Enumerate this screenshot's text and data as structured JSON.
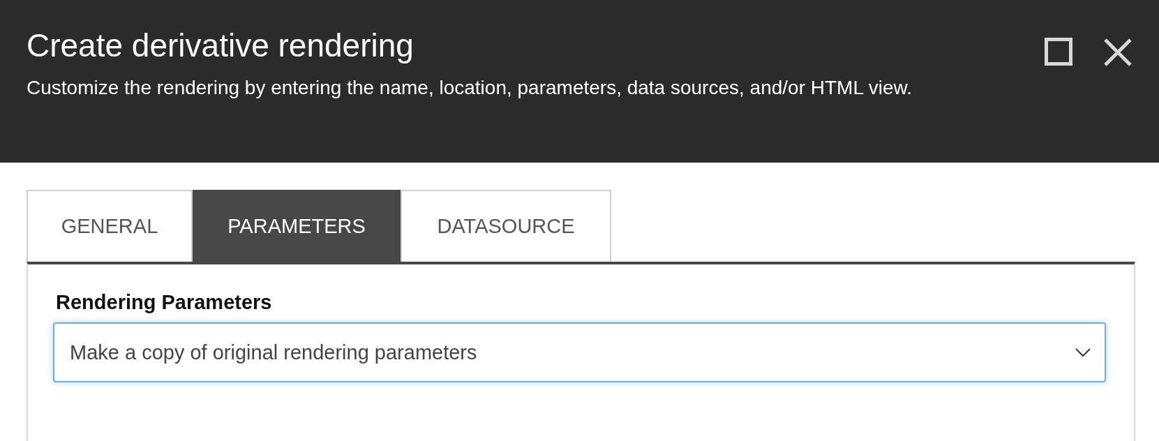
{
  "dialog": {
    "title": "Create derivative rendering",
    "subtitle": "Customize the rendering by entering the name, location, parameters, data sources, and/or HTML view."
  },
  "tabs": [
    {
      "label": "GENERAL",
      "selected": false
    },
    {
      "label": "PARAMETERS",
      "selected": true
    },
    {
      "label": "DATASOURCE",
      "selected": false
    }
  ],
  "form": {
    "label": "Rendering Parameters",
    "select": {
      "value": "Make a copy of original rendering parameters",
      "focused": true
    }
  }
}
